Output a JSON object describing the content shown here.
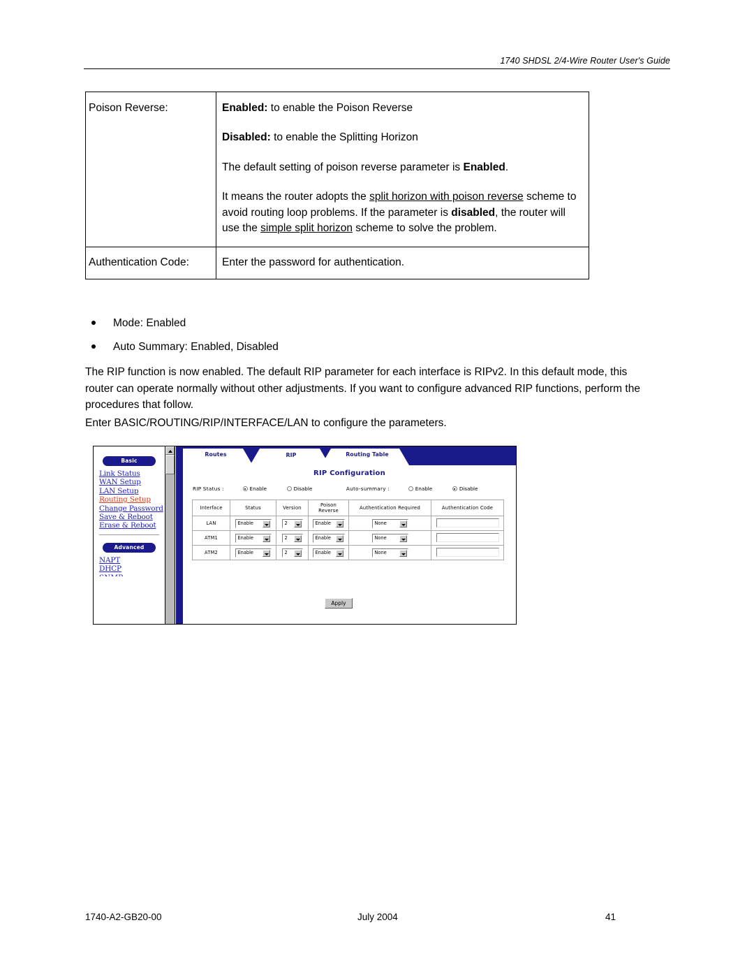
{
  "header": {
    "title": "1740 SHDSL 2/4-Wire Router User's Guide"
  },
  "parameter_table": {
    "rows": [
      {
        "label": "Poison Reverse:",
        "paragraphs": [
          {
            "bold_lead": "Enabled:",
            "rest": " to enable the Poison Reverse"
          },
          {
            "bold_lead": "Disabled:",
            "rest": " to enable the Splitting Horizon"
          },
          {
            "plain": "The default setting of poison reverse parameter is ",
            "bold_tail": "Enabled",
            "tail": "."
          },
          {
            "rich": "It means the router adopts the split horizon with poison reverse scheme to avoid routing loop problems. If the parameter is disabled, the router will use the simple split horizon scheme to solve the problem."
          }
        ],
        "segments": {
          "s1": "It means the router adopts the ",
          "s2_underline": "split horizon with poison reverse",
          "s3": " scheme to avoid routing loop problems. If the parameter is ",
          "s4_bold": "disabled",
          "s5": ", the router will use the ",
          "s6_underline": "simple split horizon",
          "s7": " scheme to solve the problem."
        }
      },
      {
        "label": "Authentication Code:",
        "description": "Enter the password for authentication."
      }
    ]
  },
  "bullets": [
    "Mode:  Enabled",
    "Auto Summary: Enabled, Disabled"
  ],
  "paragraphs": {
    "rip_intro": "The RIP function is now enabled. The default RIP parameter for each interface is RIPv2. In this default mode, this router can operate normally without other adjustments. If you want to configure advanced RIP functions, perform the procedures that follow.",
    "enter_path": "Enter BASIC/ROUTING/RIP/INTERFACE/LAN to configure the parameters."
  },
  "figure": {
    "sidebar": {
      "basic_label": "Basic",
      "basic_links": [
        "Link Status",
        "WAN Setup",
        "LAN Setup",
        "Routing Setup",
        "Change Password",
        "Save & Reboot",
        "Erase & Reboot"
      ],
      "active_link": "Routing Setup",
      "advanced_label": "Advanced",
      "advanced_links": [
        "NAPT",
        "DHCP"
      ],
      "clipped_link": "SNMP"
    },
    "tabs": [
      {
        "label": "Routes",
        "active": false
      },
      {
        "label": "RIP",
        "active": true
      },
      {
        "label": "Routing Table",
        "active": false
      }
    ],
    "panel_title": "RIP Configuration",
    "options": {
      "rip_status_label": "RIP Status :",
      "rip_status_enable": "Enable",
      "rip_status_disable": "Disable",
      "rip_status_value": "Enable",
      "auto_summary_label": "Auto-summary :",
      "auto_summary_enable": "Enable",
      "auto_summary_disable": "Disable",
      "auto_summary_value": "Disable"
    },
    "table": {
      "headers": [
        "Interface",
        "Status",
        "Version",
        "Poison Reverse",
        "Authentication Required",
        "Authentication Code"
      ],
      "poison_header_line1": "Poison",
      "poison_header_line2": "Reverse",
      "rows": [
        {
          "interface": "LAN",
          "status": "Enable",
          "version": "2",
          "poison_reverse": "Enable",
          "auth_required": "None",
          "auth_code": ""
        },
        {
          "interface": "ATM1",
          "status": "Enable",
          "version": "2",
          "poison_reverse": "Enable",
          "auth_required": "None",
          "auth_code": ""
        },
        {
          "interface": "ATM2",
          "status": "Enable",
          "version": "2",
          "poison_reverse": "Enable",
          "auth_required": "None",
          "auth_code": ""
        }
      ]
    },
    "apply_label": "Apply",
    "colors": {
      "navy": "#1a1a8c",
      "link_blue": "#2222cc",
      "active_red": "#e03b20"
    }
  },
  "footer": {
    "doc_number": "1740-A2-GB20-00",
    "date": "July 2004",
    "page_number": "41"
  }
}
